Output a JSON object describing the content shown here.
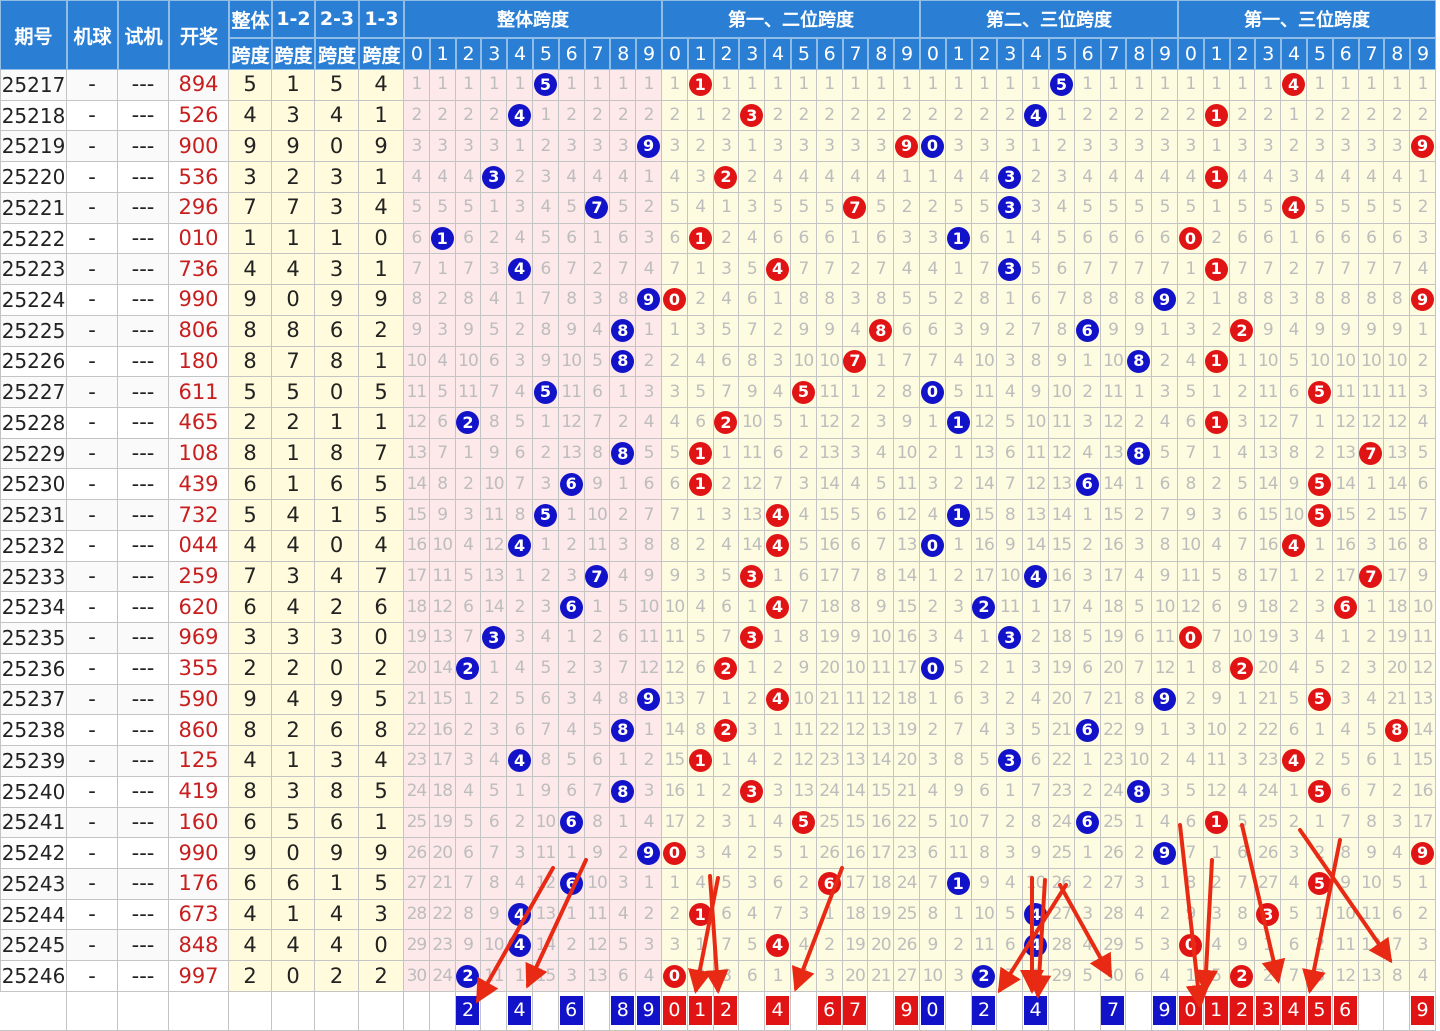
{
  "chart_data": {
    "type": "table",
    "headers": {
      "period": "期号",
      "machine": "机球",
      "trial": "试机",
      "draw": "开奖",
      "total_span": [
        "整体",
        "跨度"
      ],
      "span12": [
        "1-2",
        "跨度"
      ],
      "span23": [
        "2-3",
        "跨度"
      ],
      "span13": [
        "1-3",
        "跨度"
      ],
      "groups": [
        "整体跨度",
        "第一、二位跨度",
        "第二、三位跨度",
        "第一、三位跨度"
      ],
      "digits": [
        "0",
        "1",
        "2",
        "3",
        "4",
        "5",
        "6",
        "7",
        "8",
        "9"
      ]
    },
    "machine_value": "-",
    "trial_value": "---",
    "rows": [
      {
        "period": "25217",
        "draw": "894",
        "spans": [
          5,
          1,
          5,
          4
        ]
      },
      {
        "period": "25218",
        "draw": "526",
        "spans": [
          4,
          3,
          4,
          1
        ]
      },
      {
        "period": "25219",
        "draw": "900",
        "spans": [
          9,
          9,
          0,
          9
        ]
      },
      {
        "period": "25220",
        "draw": "536",
        "spans": [
          3,
          2,
          3,
          1
        ]
      },
      {
        "period": "25221",
        "draw": "296",
        "spans": [
          7,
          7,
          3,
          4
        ]
      },
      {
        "period": "25222",
        "draw": "010",
        "spans": [
          1,
          1,
          1,
          0
        ]
      },
      {
        "period": "25223",
        "draw": "736",
        "spans": [
          4,
          4,
          3,
          1
        ]
      },
      {
        "period": "25224",
        "draw": "990",
        "spans": [
          9,
          0,
          9,
          9
        ]
      },
      {
        "period": "25225",
        "draw": "806",
        "spans": [
          8,
          8,
          6,
          2
        ]
      },
      {
        "period": "25226",
        "draw": "180",
        "spans": [
          8,
          7,
          8,
          1
        ]
      },
      {
        "period": "25227",
        "draw": "611",
        "spans": [
          5,
          5,
          0,
          5
        ]
      },
      {
        "period": "25228",
        "draw": "465",
        "spans": [
          2,
          2,
          1,
          1
        ]
      },
      {
        "period": "25229",
        "draw": "108",
        "spans": [
          8,
          1,
          8,
          7
        ]
      },
      {
        "period": "25230",
        "draw": "439",
        "spans": [
          6,
          1,
          6,
          5
        ]
      },
      {
        "period": "25231",
        "draw": "732",
        "spans": [
          5,
          4,
          1,
          5
        ]
      },
      {
        "period": "25232",
        "draw": "044",
        "spans": [
          4,
          4,
          0,
          4
        ]
      },
      {
        "period": "25233",
        "draw": "259",
        "spans": [
          7,
          3,
          4,
          7
        ]
      },
      {
        "period": "25234",
        "draw": "620",
        "spans": [
          6,
          4,
          2,
          6
        ]
      },
      {
        "period": "25235",
        "draw": "969",
        "spans": [
          3,
          3,
          3,
          0
        ]
      },
      {
        "period": "25236",
        "draw": "355",
        "spans": [
          2,
          2,
          0,
          2
        ]
      },
      {
        "period": "25237",
        "draw": "590",
        "spans": [
          9,
          4,
          9,
          5
        ]
      },
      {
        "period": "25238",
        "draw": "860",
        "spans": [
          8,
          2,
          6,
          8
        ]
      },
      {
        "period": "25239",
        "draw": "125",
        "spans": [
          4,
          1,
          3,
          4
        ]
      },
      {
        "period": "25240",
        "draw": "419",
        "spans": [
          8,
          3,
          8,
          5
        ]
      },
      {
        "period": "25241",
        "draw": "160",
        "spans": [
          6,
          5,
          6,
          1
        ]
      },
      {
        "period": "25242",
        "draw": "990",
        "spans": [
          9,
          0,
          9,
          9
        ]
      },
      {
        "period": "25243",
        "draw": "176",
        "spans": [
          6,
          6,
          1,
          5
        ]
      },
      {
        "period": "25244",
        "draw": "673",
        "spans": [
          4,
          1,
          4,
          3
        ]
      },
      {
        "period": "25245",
        "draw": "848",
        "spans": [
          4,
          4,
          4,
          0
        ]
      },
      {
        "period": "25246",
        "draw": "997",
        "spans": [
          2,
          0,
          2,
          2
        ]
      }
    ],
    "prediction_row": {
      "total_span": [
        "2",
        "4",
        "6",
        "8",
        "9"
      ],
      "span12": [
        "0",
        "1",
        "2",
        "4",
        "6",
        "7",
        "9"
      ],
      "span23": [
        "0",
        "2",
        "4",
        "7",
        "9"
      ],
      "span13": [
        "0",
        "1",
        "2",
        "3",
        "4",
        "5",
        "6",
        "9"
      ]
    },
    "colors": {
      "header_bg": "#2a7fd4",
      "ball_blue": "#1212c8",
      "ball_red": "#e01414",
      "draw_text": "#c81e1e",
      "stats_bg": "#fffbdc",
      "total_span_bg": "#fde8ea",
      "pair_span_bg": "#fdfbe0",
      "arrow": "#e82a14"
    }
  }
}
